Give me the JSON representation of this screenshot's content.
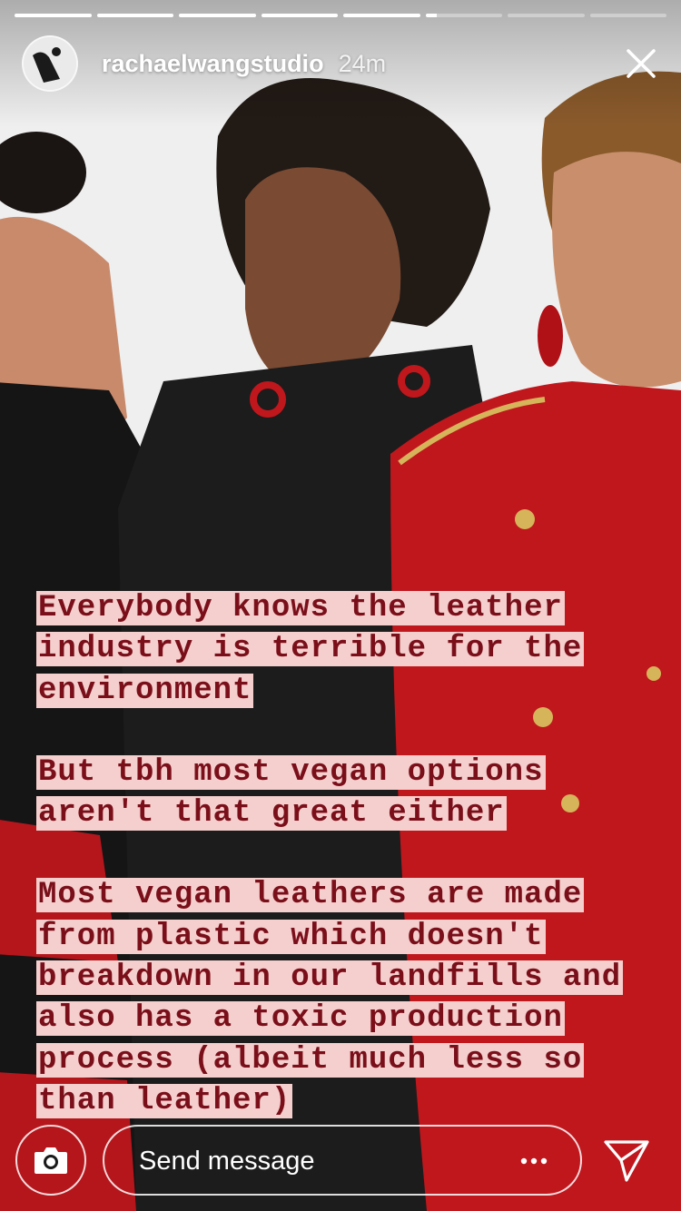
{
  "story": {
    "progress": [
      1,
      1,
      1,
      1,
      1,
      0.15,
      0,
      0
    ],
    "username": "rachaelwangstudio",
    "timestamp": "24m"
  },
  "caption": {
    "paragraphs": [
      "Everybody knows the leather industry is terrible for the environment",
      "But tbh most vegan options aren't that great either",
      "Most vegan leathers are made from plastic which doesn't breakdown in our landfills and also has a toxic production process (albeit much less so than leather)"
    ]
  },
  "composer": {
    "placeholder": "Send message"
  },
  "icons": {
    "close": "close-icon",
    "camera": "camera-icon",
    "more": "more-icon",
    "send": "send-icon"
  },
  "colors": {
    "caption_text": "#7a0f1a",
    "caption_highlight": "#f5cfcd",
    "jacket_red": "#c0171d"
  }
}
